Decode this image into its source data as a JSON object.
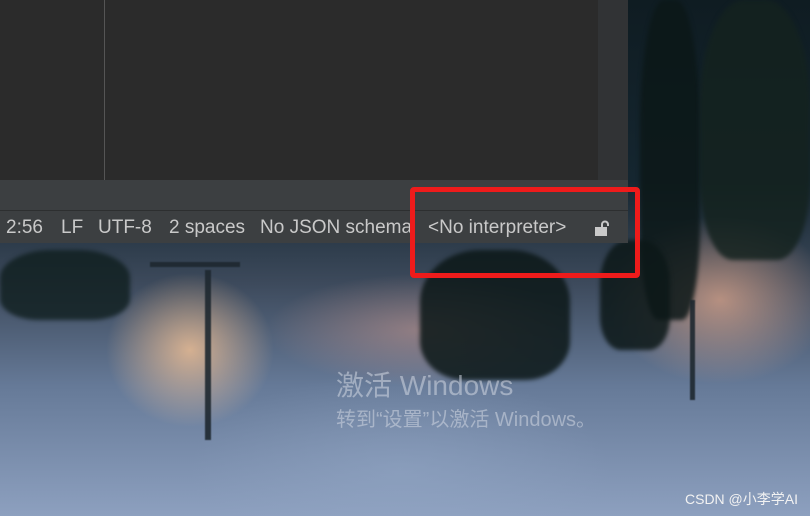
{
  "status_bar": {
    "position": "2:56",
    "line_separator": "LF",
    "encoding": "UTF-8",
    "indent": "2 spaces",
    "json_schema": "No JSON schema",
    "interpreter": "<No interpreter>",
    "lock_icon": "unlocked-lock-icon"
  },
  "annotation": {
    "highlight_color": "#ee1b1b"
  },
  "watermark": {
    "title": "激活 Windows",
    "subtitle": "转到“设置”以激活 Windows。"
  },
  "credit": {
    "text": "CSDN @小李学AI"
  },
  "colors": {
    "ide_background": "#2b2b2b",
    "status_bar_background": "#3c3f41",
    "status_text": "#c9c9c9"
  }
}
